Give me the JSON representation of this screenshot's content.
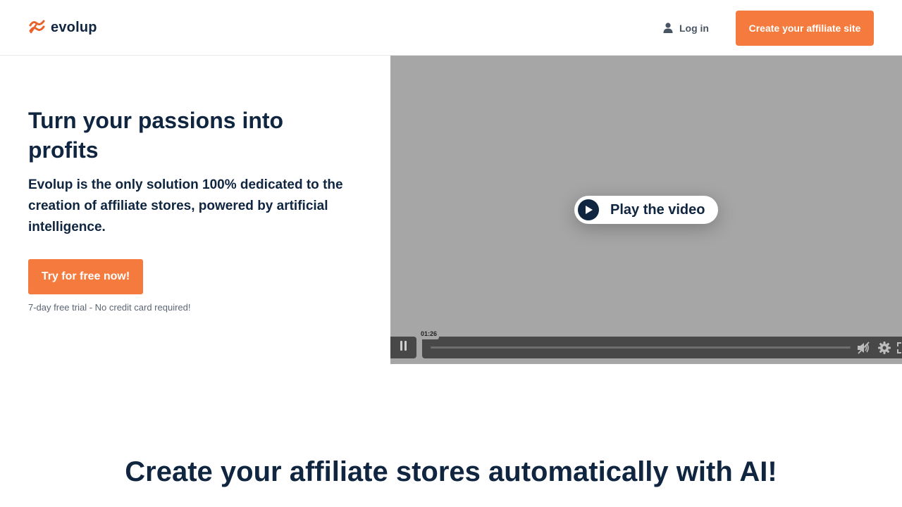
{
  "header": {
    "logo_text": "evolup",
    "login_label": "Log in",
    "cta_label": "Create your affiliate site"
  },
  "hero": {
    "title": "Turn your passions into profits",
    "subtitle": "Evolup is the only solution 100% dedicated to the creation of affiliate stores, powered by artificial intelligence.",
    "cta_label": "Try for free now!",
    "note": "7-day free trial - No credit card required!"
  },
  "video": {
    "play_label": "Play the video",
    "time": "01:26"
  },
  "section": {
    "title": "Create your affiliate stores automatically with AI!"
  },
  "colors": {
    "brand_orange": "#f57a3d",
    "navy": "#0f2540",
    "video_bg": "#a6a6a6"
  },
  "icons": [
    "evolup-logo-icon",
    "user-icon",
    "play-icon",
    "pause-icon",
    "mute-icon",
    "gear-icon",
    "fullscreen-icon"
  ]
}
